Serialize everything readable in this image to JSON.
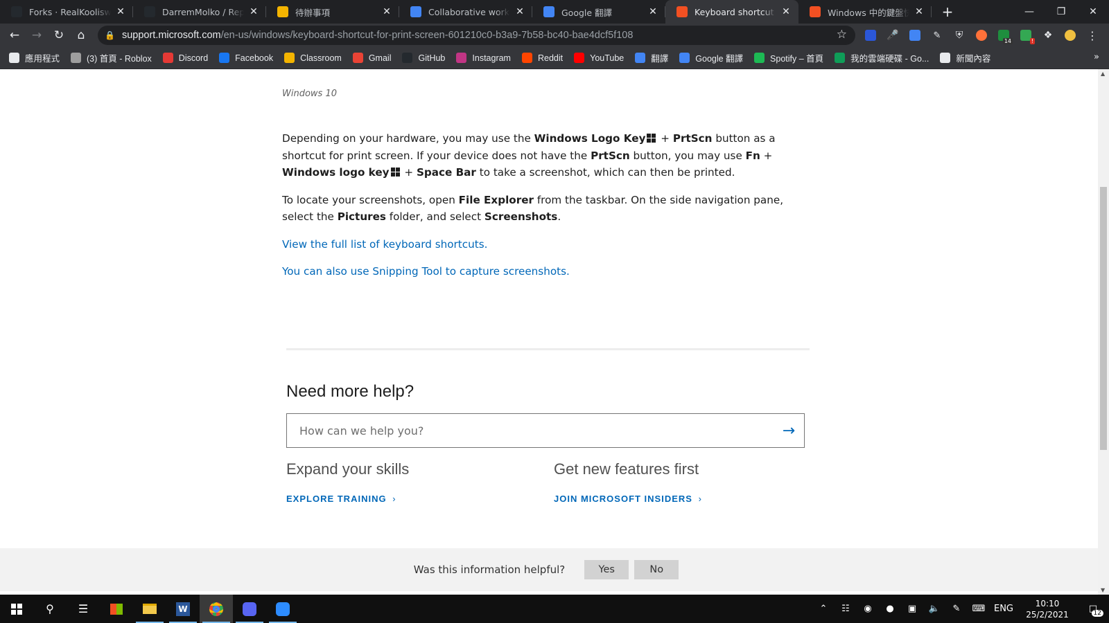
{
  "browser": {
    "tabs": [
      {
        "title": "Forks · RealKooliswVirt",
        "favicon_color": "#24292e",
        "active": false
      },
      {
        "title": "DarremMolko / Reposit",
        "favicon_color": "#24292e",
        "active": false
      },
      {
        "title": "待辦事項",
        "favicon_color": "#f4b400",
        "active": false
      },
      {
        "title": "Collaborative work - Co",
        "favicon_color": "#4285f4",
        "active": false
      },
      {
        "title": "Google 翻譯",
        "favicon_color": "#4285f4",
        "active": false
      },
      {
        "title": "Keyboard shortcut for p",
        "favicon_color": "#f25022",
        "active": true
      },
      {
        "title": "Windows 中的鍵盤快速",
        "favicon_color": "#f25022",
        "active": false
      }
    ],
    "url_host": "support.microsoft.com",
    "url_path": "/en-us/windows/keyboard-shortcut-for-print-screen-601210c0-b3a9-7b58-bc40-bae4dcf5f108",
    "extension_badges": {
      "ext5": "14",
      "ext6": "!"
    },
    "bookmarks": [
      {
        "label": "應用程式",
        "icon_color": "#e8eaed"
      },
      {
        "label": "(3) 首頁 - Roblox",
        "icon_color": "#9e9e9e"
      },
      {
        "label": "Discord",
        "icon_color": "#e53935"
      },
      {
        "label": "Facebook",
        "icon_color": "#1877f2"
      },
      {
        "label": "Classroom",
        "icon_color": "#f4b400"
      },
      {
        "label": "Gmail",
        "icon_color": "#ea4335"
      },
      {
        "label": "GitHub",
        "icon_color": "#24292e"
      },
      {
        "label": "Instagram",
        "icon_color": "#c13584"
      },
      {
        "label": "Reddit",
        "icon_color": "#ff4500"
      },
      {
        "label": "YouTube",
        "icon_color": "#ff0000"
      },
      {
        "label": "翻譯",
        "icon_color": "#4285f4"
      },
      {
        "label": "Google 翻譯",
        "icon_color": "#4285f4"
      },
      {
        "label": "Spotify – 首頁",
        "icon_color": "#1db954"
      },
      {
        "label": "我的雲端硬碟 - Go...",
        "icon_color": "#0f9d58"
      },
      {
        "label": "新聞內容",
        "icon_color": "#e8eaed"
      }
    ]
  },
  "article": {
    "applies_to": "Windows 10",
    "p1": {
      "t1": "Depending on your hardware, you may use the ",
      "b1": "Windows Logo Key",
      "t2": " + ",
      "b2": "PrtScn",
      "t3": " button as a shortcut for print screen. If your device does not have the ",
      "b3": "PrtScn",
      "t4": " button, you may use ",
      "b4": "Fn",
      "t5": " + ",
      "b5": "Windows logo key",
      "t6": " + ",
      "b6": "Space Bar",
      "t7": " to take a screenshot, which can then be printed."
    },
    "p2": {
      "t1": "To locate your screenshots, open ",
      "b1": "File Explorer",
      "t2": " from the taskbar. On the side navigation pane, select the ",
      "b2": "Pictures",
      "t3": " folder, and select ",
      "b3": "Screenshots",
      "t4": "."
    },
    "link1": "View the full list of keyboard shortcuts.",
    "link2": "You can also use Snipping Tool to capture screenshots."
  },
  "help": {
    "title": "Need more help?",
    "search_placeholder": "How can we help you?",
    "col1_title": "Expand your skills",
    "col1_cta": "EXPLORE TRAINING",
    "col2_title": "Get new features first",
    "col2_cta": "JOIN MICROSOFT INSIDERS"
  },
  "feedback": {
    "question": "Was this information helpful?",
    "yes": "Yes",
    "no": "No"
  },
  "taskbar": {
    "language": "ENG",
    "time": "10:10",
    "date": "25/2/2021",
    "notification_count": "12"
  },
  "colors": {
    "link": "#0067b8",
    "chrome_dark": "#202124",
    "chrome_toolbar": "#35363a"
  }
}
